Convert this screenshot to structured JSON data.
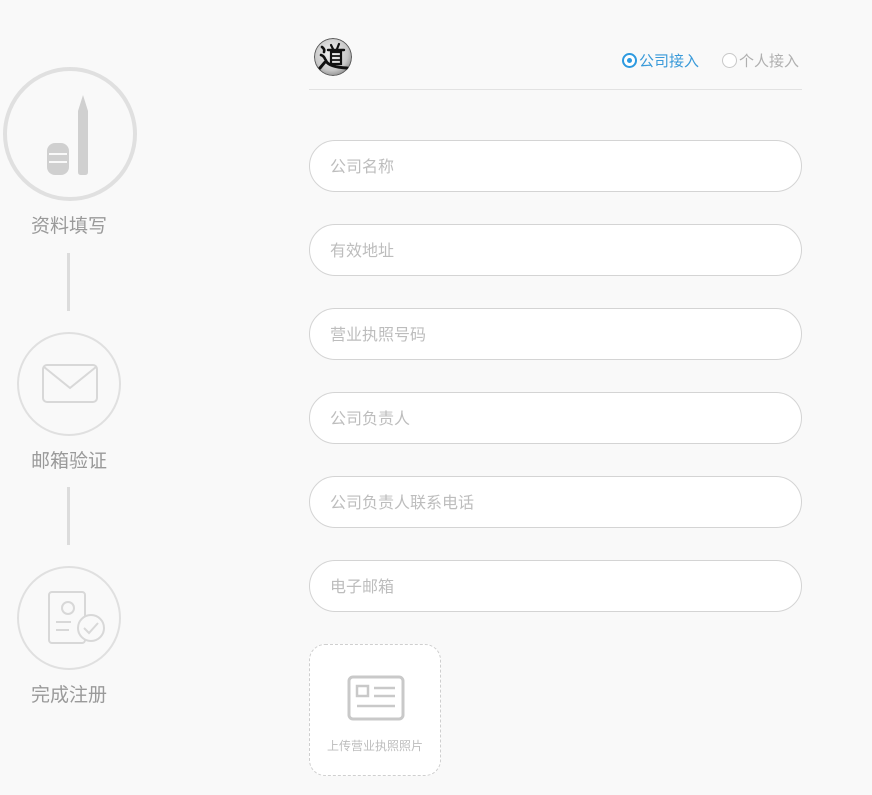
{
  "steps": [
    {
      "label": "资料填写",
      "icon": "pen-icon",
      "state": "active"
    },
    {
      "label": "邮箱验证",
      "icon": "envelope-icon",
      "state": "pending"
    },
    {
      "label": "完成注册",
      "icon": "document-check-icon",
      "state": "pending"
    }
  ],
  "header": {
    "logo_icon": "dao-logo-icon",
    "access_types": {
      "company": {
        "label": "公司接入",
        "selected": true
      },
      "personal": {
        "label": "个人接入",
        "selected": false
      }
    }
  },
  "form": {
    "fields": {
      "company_name": {
        "placeholder": "公司名称",
        "value": ""
      },
      "address": {
        "placeholder": "有效地址",
        "value": ""
      },
      "license_number": {
        "placeholder": "营业执照号码",
        "value": ""
      },
      "person_in_charge": {
        "placeholder": "公司负责人",
        "value": ""
      },
      "contact_phone": {
        "placeholder": "公司负责人联系电话",
        "value": ""
      },
      "email": {
        "placeholder": "电子邮箱",
        "value": ""
      }
    },
    "upload": {
      "label": "上传营业执照照片",
      "icon": "id-card-icon"
    }
  },
  "colors": {
    "accent": "#2d9ae0",
    "muted_text": "#9a9a9a",
    "placeholder": "#bdbdbd",
    "border": "#d4d4d4",
    "background": "#f9f9f9"
  }
}
